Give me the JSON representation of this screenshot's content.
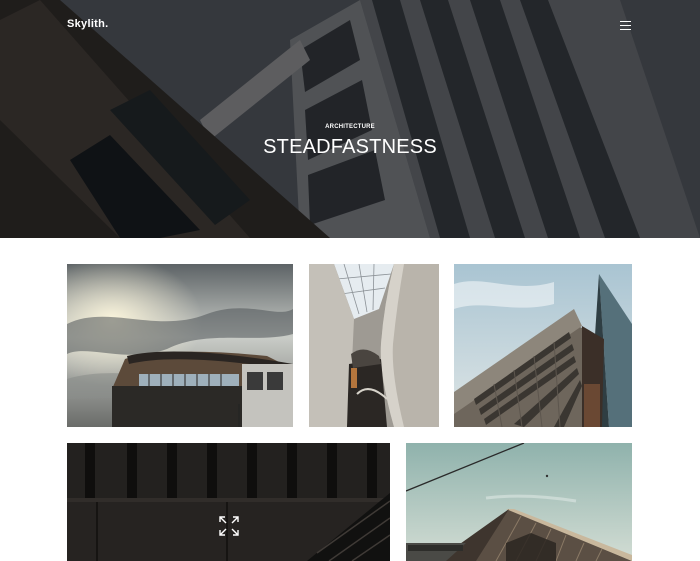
{
  "header": {
    "brand": "Skylith.",
    "menu_icon": "hamburger-menu-icon"
  },
  "hero": {
    "category": "ARCHITECTURE",
    "title": "STEADFASTNESS"
  },
  "gallery": {
    "items": [
      {
        "subject": "building-with-curved-roof-cloudy-sky"
      },
      {
        "subject": "interior-concrete-curves"
      },
      {
        "subject": "tower-looking-up-blue-sky"
      },
      {
        "subject": "dark-building-staircase"
      },
      {
        "subject": "gabled-roof-teal-sky"
      }
    ],
    "expand_icon": "expand-arrows-icon"
  },
  "colors": {
    "hero_overlay": "#3d4047",
    "text_on_hero": "#ffffff",
    "page_background": "#ffffff"
  }
}
